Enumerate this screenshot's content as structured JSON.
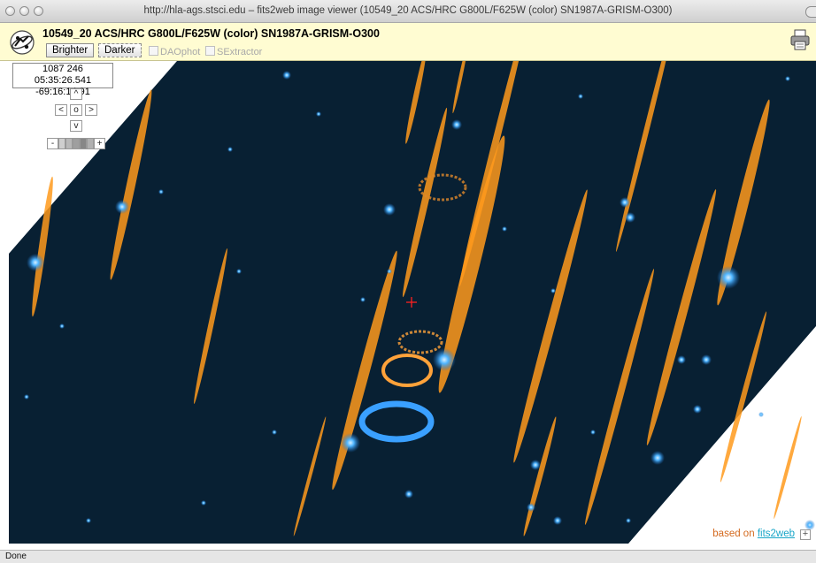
{
  "window": {
    "title": "http://hla-ags.stsci.edu – fits2web image viewer (10549_20 ACS/HRC G800L/F625W (color) SN1987A-GRISM-O300)"
  },
  "header": {
    "image_title": "10549_20 ACS/HRC G800L/F625W (color) SN1987A-GRISM-O300",
    "brighter_label": "Brighter",
    "darker_label": "Darker",
    "daophot_label": "DAOphot",
    "sextractor_label": "SExtractor",
    "icons": {
      "logo": "hubble-logo-icon",
      "print": "printer-icon"
    }
  },
  "viewer": {
    "pixel_coords": "1087 246",
    "sky_coords": "05:35:26.541 -69:16:14.91",
    "nav": {
      "up": "^",
      "left": "<",
      "center": "o",
      "right": ">",
      "down": "v",
      "zoom_out": "-",
      "zoom_in": "+"
    },
    "colors": {
      "sky": "#082033",
      "streak": "#ff9a1c",
      "star": "#35a8ff",
      "crosshair": "#ff2020"
    }
  },
  "footer": {
    "based_on": "based on",
    "link": "fits2web",
    "expand": "+"
  },
  "status": {
    "text": "Done"
  }
}
